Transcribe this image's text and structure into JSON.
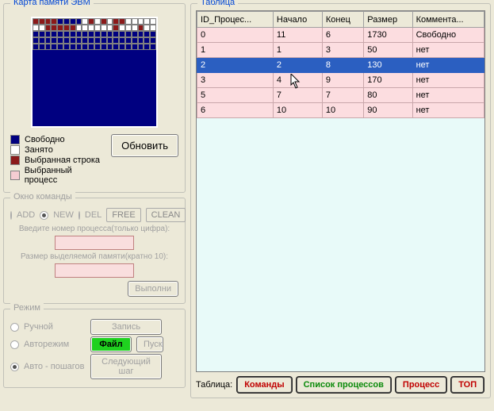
{
  "memory_map": {
    "title": "Карта памяти ЭВМ",
    "legend": {
      "free": "Свободно",
      "busy": "Занято",
      "selected_row": "Выбранная строка",
      "selected_process": "Выбранный процесс"
    },
    "refresh": "Обновить"
  },
  "command_window": {
    "title": "Окно команды",
    "ops": {
      "add": "ADD",
      "new": "NEW",
      "del": "DEL",
      "free": "FREE",
      "clean": "CLEAN"
    },
    "proc_prompt": "Введите номер процесса(только цифра):",
    "size_prompt": "Размер выделяемой памяти(кратно 10):",
    "execute": "Выполни"
  },
  "mode": {
    "title": "Режим",
    "manual": "Ручной",
    "auto": "Авторежим",
    "step": "Авто - пошагов",
    "record": "Запись",
    "file": "Файл",
    "run": "Пуск",
    "next_step": "Следующий шаг"
  },
  "table": {
    "title": "Таблица",
    "columns": [
      "ID_Процес...",
      "Начало",
      "Конец",
      "Размер",
      "Коммента..."
    ],
    "rows": [
      {
        "id": "0",
        "start": "11",
        "end": "6",
        "size": "1730",
        "comment": "Свободно",
        "selected": false
      },
      {
        "id": "1",
        "start": "1",
        "end": "3",
        "size": "50",
        "comment": "нет",
        "selected": false
      },
      {
        "id": "2",
        "start": "2",
        "end": "8",
        "size": "130",
        "comment": "нет",
        "selected": true
      },
      {
        "id": "3",
        "start": "4",
        "end": "9",
        "size": "170",
        "comment": "нет",
        "selected": false
      },
      {
        "id": "5",
        "start": "7",
        "end": "7",
        "size": "80",
        "comment": "нет",
        "selected": false
      },
      {
        "id": "6",
        "start": "10",
        "end": "10",
        "size": "90",
        "comment": "нет",
        "selected": false
      }
    ]
  },
  "bottom": {
    "label": "Таблица:",
    "commands": "Команды",
    "proc_list": "Список процессов",
    "process": "Процесс",
    "top": "ТОП"
  },
  "memmap_cells": [
    [
      "sel-row",
      "sel-row",
      "sel-row",
      "sel-row",
      "free",
      "free",
      "free",
      "free",
      "busy",
      "sel-row",
      "busy",
      "sel-row",
      "busy",
      "sel-row",
      "sel-row",
      "busy",
      "busy",
      "busy",
      "busy",
      "busy"
    ],
    [
      "busy",
      "busy",
      "sel-row",
      "sel-row",
      "sel-row",
      "sel-row",
      "sel-row",
      "busy",
      "busy",
      "busy",
      "busy",
      "busy",
      "busy",
      "sel-row",
      "busy",
      "busy",
      "busy",
      "sel-row",
      "busy",
      "busy"
    ],
    [
      "free",
      "free",
      "free",
      "free",
      "free",
      "free",
      "free",
      "free",
      "free",
      "free",
      "free",
      "free",
      "free",
      "free",
      "free",
      "free",
      "free",
      "free",
      "free",
      "free"
    ],
    [
      "free",
      "free",
      "free",
      "free",
      "free",
      "free",
      "free",
      "free",
      "free",
      "free",
      "free",
      "free",
      "free",
      "free",
      "free",
      "free",
      "free",
      "free",
      "free",
      "free"
    ],
    [
      "free",
      "free",
      "free",
      "free",
      "free",
      "free",
      "free",
      "free",
      "free",
      "free",
      "free",
      "free",
      "free",
      "free",
      "free",
      "free",
      "free",
      "free",
      "free",
      "free"
    ]
  ]
}
